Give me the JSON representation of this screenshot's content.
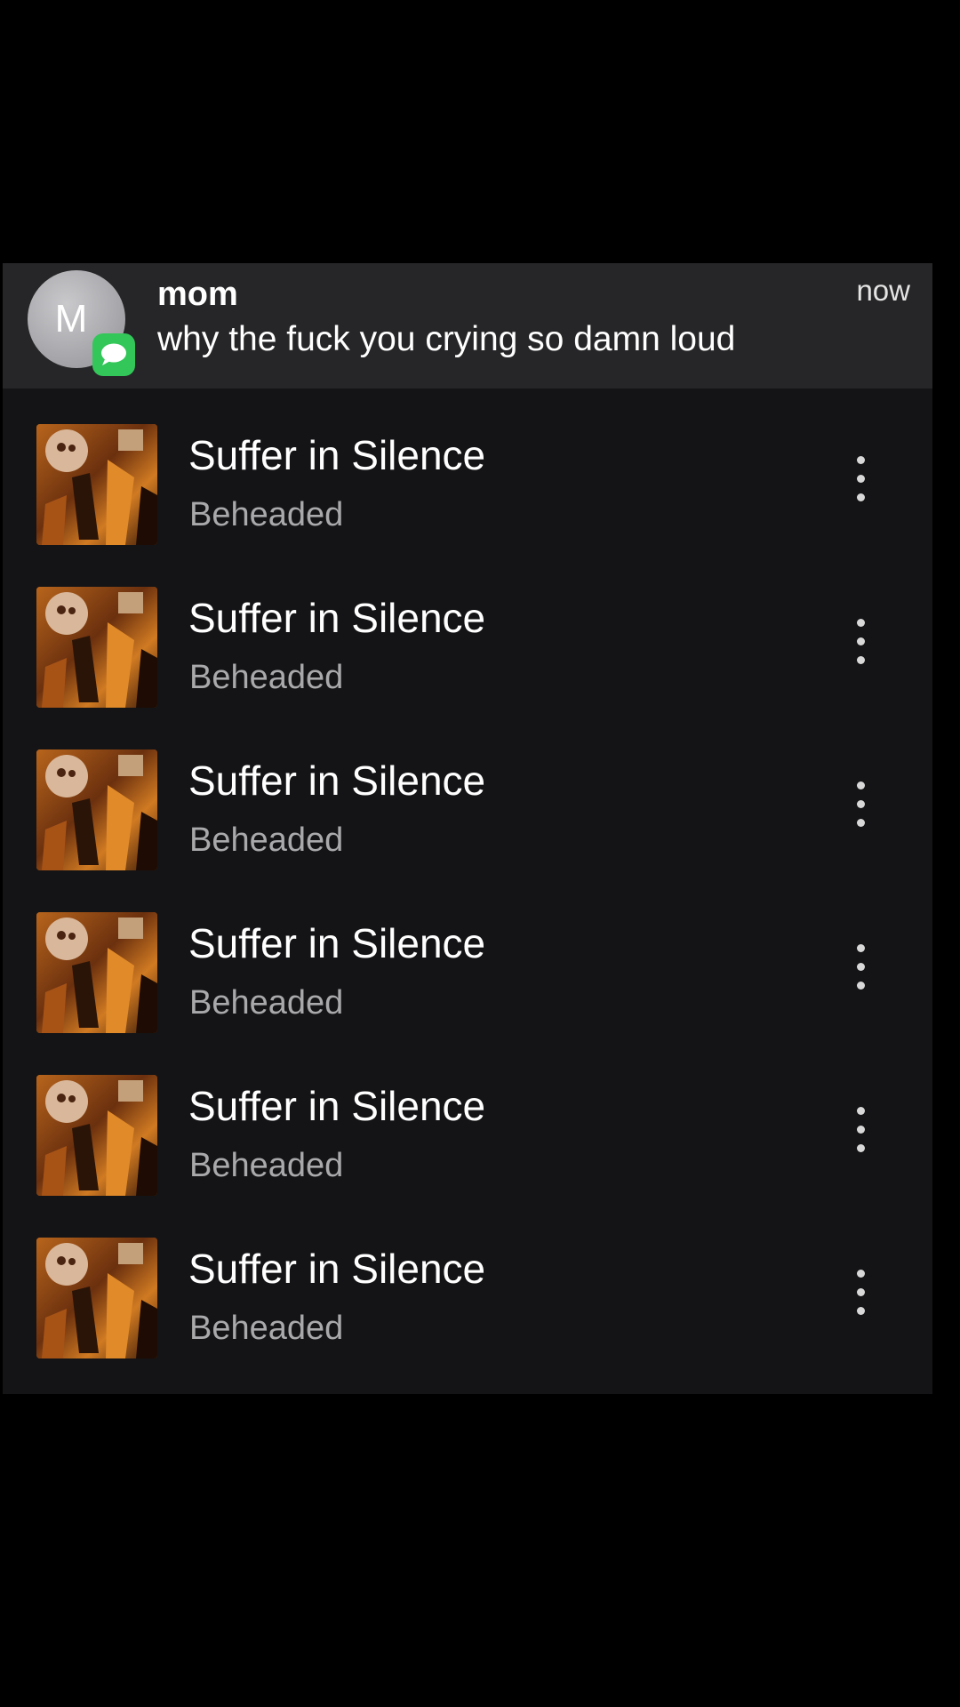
{
  "notification": {
    "avatar_letter": "M",
    "app_icon": "messages-icon",
    "sender": "mom",
    "message": "why the fuck you crying so damn loud",
    "time": "now"
  },
  "tracks": [
    {
      "title": "Suffer in Silence",
      "artist": "Beheaded"
    },
    {
      "title": "Suffer in Silence",
      "artist": "Beheaded"
    },
    {
      "title": "Suffer in Silence",
      "artist": "Beheaded"
    },
    {
      "title": "Suffer in Silence",
      "artist": "Beheaded"
    },
    {
      "title": "Suffer in Silence",
      "artist": "Beheaded"
    },
    {
      "title": "Suffer in Silence",
      "artist": "Beheaded"
    }
  ],
  "icons": {
    "more": "more-vertical-icon",
    "album_art": "album-art"
  },
  "colors": {
    "background": "#000000",
    "panel": "#141416",
    "notification": "#262628",
    "badge": "#33c759",
    "secondary_text": "#a9a9ab"
  }
}
